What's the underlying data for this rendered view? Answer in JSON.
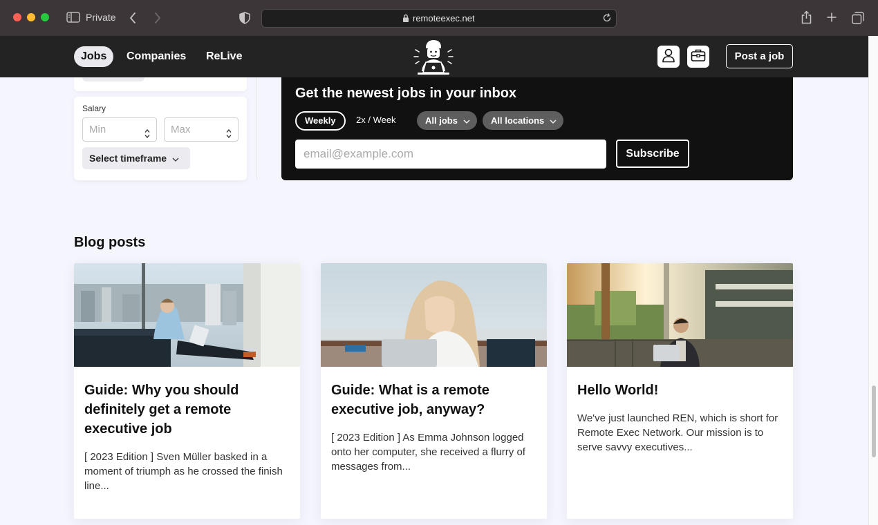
{
  "browser": {
    "mode_label": "Private",
    "url": "remoteexec.net"
  },
  "nav": {
    "items": [
      {
        "label": "Jobs",
        "active": true
      },
      {
        "label": "Companies",
        "active": false
      },
      {
        "label": "ReLive",
        "active": false
      }
    ],
    "post_job_label": "Post a job"
  },
  "filters": {
    "salary_label": "Salary",
    "min_placeholder": "Min",
    "max_placeholder": "Max",
    "timeframe_label": "Select timeframe"
  },
  "newsletter": {
    "title": "Get the newest jobs in your inbox",
    "frequencies": [
      "Weekly",
      "2x / Week"
    ],
    "selected_frequency": "Weekly",
    "jobs_dropdown": "All jobs",
    "locations_dropdown": "All locations",
    "email_placeholder": "email@example.com",
    "subscribe_label": "Subscribe"
  },
  "blog": {
    "heading": "Blog posts",
    "posts": [
      {
        "title": "Guide: Why you should definitely get a remote executive job",
        "excerpt": "[ 2023 Edition ] Sven Müller basked in a moment of triumph as he crossed the finish line..."
      },
      {
        "title": "Guide: What is a remote executive job, anyway?",
        "excerpt": "[ 2023 Edition ] As Emma Johnson logged onto her computer, she received a flurry of messages from..."
      },
      {
        "title": "Hello World!",
        "excerpt": "We've just launched REN, which is short for Remote Exec Network. Our mission is to serve savvy executives..."
      }
    ]
  },
  "colors": {
    "header_bg": "#232323",
    "newsletter_bg": "#111111",
    "page_bg": "#f5f5fd",
    "chrome_bg": "#3c3639"
  }
}
